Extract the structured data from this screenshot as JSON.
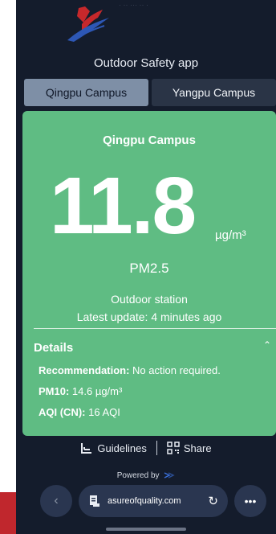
{
  "app": {
    "title": "Outdoor Safety app"
  },
  "tabs": [
    {
      "label": "Qingpu Campus",
      "active": true
    },
    {
      "label": "Yangpu Campus",
      "active": false
    }
  ],
  "reading": {
    "campus": "Qingpu Campus",
    "value": "11.8",
    "unit": "µg/m³",
    "pollutant": "PM2.5",
    "station": "Outdoor station",
    "updated": "Latest update: 4 minutes ago",
    "status_color": "#5fbc83"
  },
  "details": {
    "header": "Details",
    "recommendation_label": "Recommendation:",
    "recommendation_value": "No action required.",
    "pm10_label": "PM10:",
    "pm10_value": "14.6 µg/m³",
    "aqi_label": "AQI (CN):",
    "aqi_value": "16 AQI"
  },
  "footer": {
    "guidelines": "Guidelines",
    "share": "Share",
    "powered_by": "Powered by"
  },
  "browser": {
    "url": "asureofquality.com",
    "back_icon": "chevron-left-icon",
    "reload_icon": "reload-icon",
    "more_icon": "more-icon"
  }
}
